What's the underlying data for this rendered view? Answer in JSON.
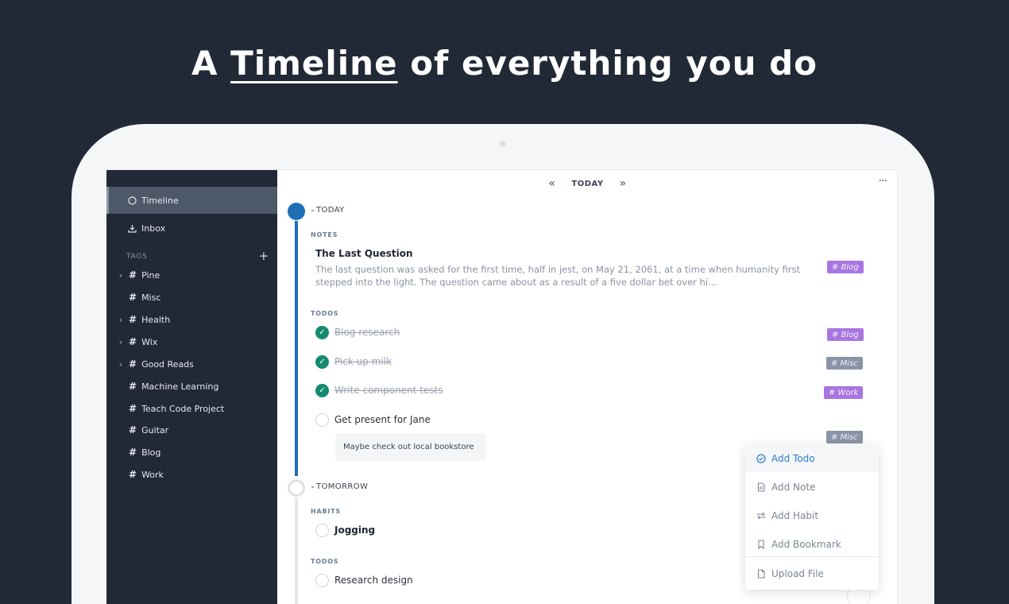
{
  "headline": {
    "prefix": "A",
    "highlight": "Timeline",
    "suffix": "of everything you do"
  },
  "sidebar": {
    "nav": [
      {
        "label": "Timeline",
        "icon": "circle-icon",
        "active": true
      },
      {
        "label": "Inbox",
        "icon": "inbox-download-icon",
        "active": false
      }
    ],
    "tags_header": "TAGS",
    "add_tag": "+",
    "tags": [
      {
        "label": "Pine",
        "expandable": true
      },
      {
        "label": "Misc",
        "expandable": false
      },
      {
        "label": "Health",
        "expandable": true
      },
      {
        "label": "Wix",
        "expandable": true
      },
      {
        "label": "Good Reads",
        "expandable": true
      },
      {
        "label": "Machine Learning",
        "expandable": false
      },
      {
        "label": "Teach Code Project",
        "expandable": false
      },
      {
        "label": "Guitar",
        "expandable": false
      },
      {
        "label": "Blog",
        "expandable": false
      },
      {
        "label": "Work",
        "expandable": false
      }
    ]
  },
  "topnav": {
    "prev": "«",
    "label": "TODAY",
    "next": "»",
    "more": "···"
  },
  "today": {
    "header": "TODAY",
    "chevron": "›",
    "notes_label": "NOTES",
    "note": {
      "title": "The Last Question",
      "body": "The last question was asked for the first time, half in jest, on May 21, 2061, at a time when humanity first stepped into the light. The question came about as a result of a five dollar bet over hi...",
      "tag": "# Blog"
    },
    "todos_label": "TODOS",
    "todos": [
      {
        "text": "Blog research",
        "done": true,
        "tag": "# Blog"
      },
      {
        "text": "Pick up milk",
        "done": true,
        "tag": "# Misc"
      },
      {
        "text": "Write component tests",
        "done": true,
        "tag": "# Work"
      },
      {
        "text": "Get present for Jane",
        "done": false,
        "tag": "# Misc",
        "subnote": "Maybe check out local bookstore"
      }
    ]
  },
  "tomorrow": {
    "header": "TOMORROW",
    "habits_label": "HABITS",
    "habits": [
      {
        "text": "Jogging"
      }
    ],
    "todos_label": "TODOS",
    "todos": [
      {
        "text": "Research design"
      }
    ]
  },
  "menu": {
    "items": [
      {
        "label": "Add Todo",
        "icon": "check-circle-icon",
        "active": true
      },
      {
        "label": "Add Note",
        "icon": "note-icon",
        "active": false
      },
      {
        "label": "Add Habit",
        "icon": "repeat-icon",
        "active": false
      },
      {
        "label": "Add Bookmark",
        "icon": "bookmark-icon",
        "active": false
      },
      {
        "label": "Upload File",
        "icon": "file-icon",
        "active": false
      }
    ]
  },
  "colors": {
    "background": "#212936",
    "accent": "#1e6fb5",
    "done_check": "#158a70",
    "tag_purple": "#a975e0",
    "tag_gray": "#8a94a6",
    "menu_active": "#2f7fc4"
  }
}
